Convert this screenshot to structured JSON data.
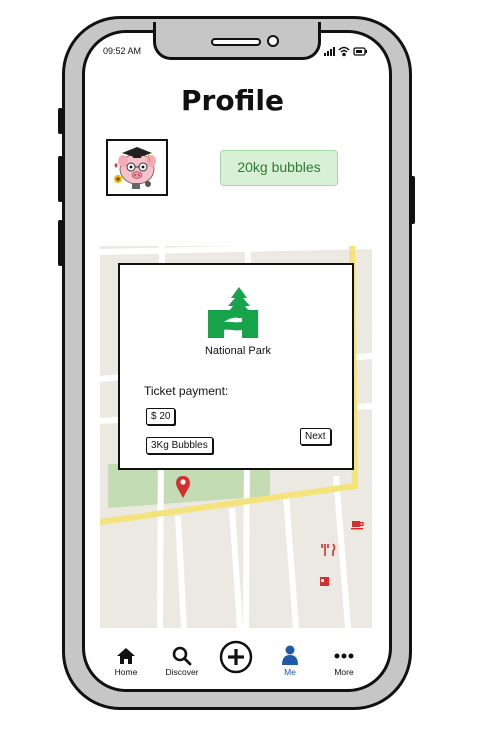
{
  "status_bar": {
    "time": "09:52 AM",
    "icons": [
      "signal-icon",
      "wifi-icon",
      "battery-icon"
    ]
  },
  "header": {
    "title": "Profile"
  },
  "profile": {
    "avatar": "pig-avatar",
    "bubbles_badge": "20kg bubbles"
  },
  "ticket_card": {
    "park_name": "National Park",
    "ticket_label": "Ticket payment:",
    "price_option": "$ 20",
    "bubbles_option": "3Kg Bubbles",
    "next_label": "Next"
  },
  "map": {
    "icons": [
      "location-pin-icon",
      "cafe-icon",
      "restaurant-icon",
      "coffee-cup-icon"
    ]
  },
  "tabbar": {
    "items": [
      {
        "label": "Home",
        "icon": "home-icon"
      },
      {
        "label": "Discover",
        "icon": "search-icon"
      },
      {
        "label": "",
        "icon": "plus-circle-icon"
      },
      {
        "label": "Me",
        "icon": "person-icon"
      },
      {
        "label": "More",
        "icon": "more-dots-icon"
      }
    ],
    "active_index": 3
  },
  "colors": {
    "accent_green": "#2e7d32",
    "badge_bg": "#d7f0d6",
    "active_tab": "#1e5aa8",
    "map_pin": "#d32f2f",
    "road_yellow": "#f4e27a"
  }
}
